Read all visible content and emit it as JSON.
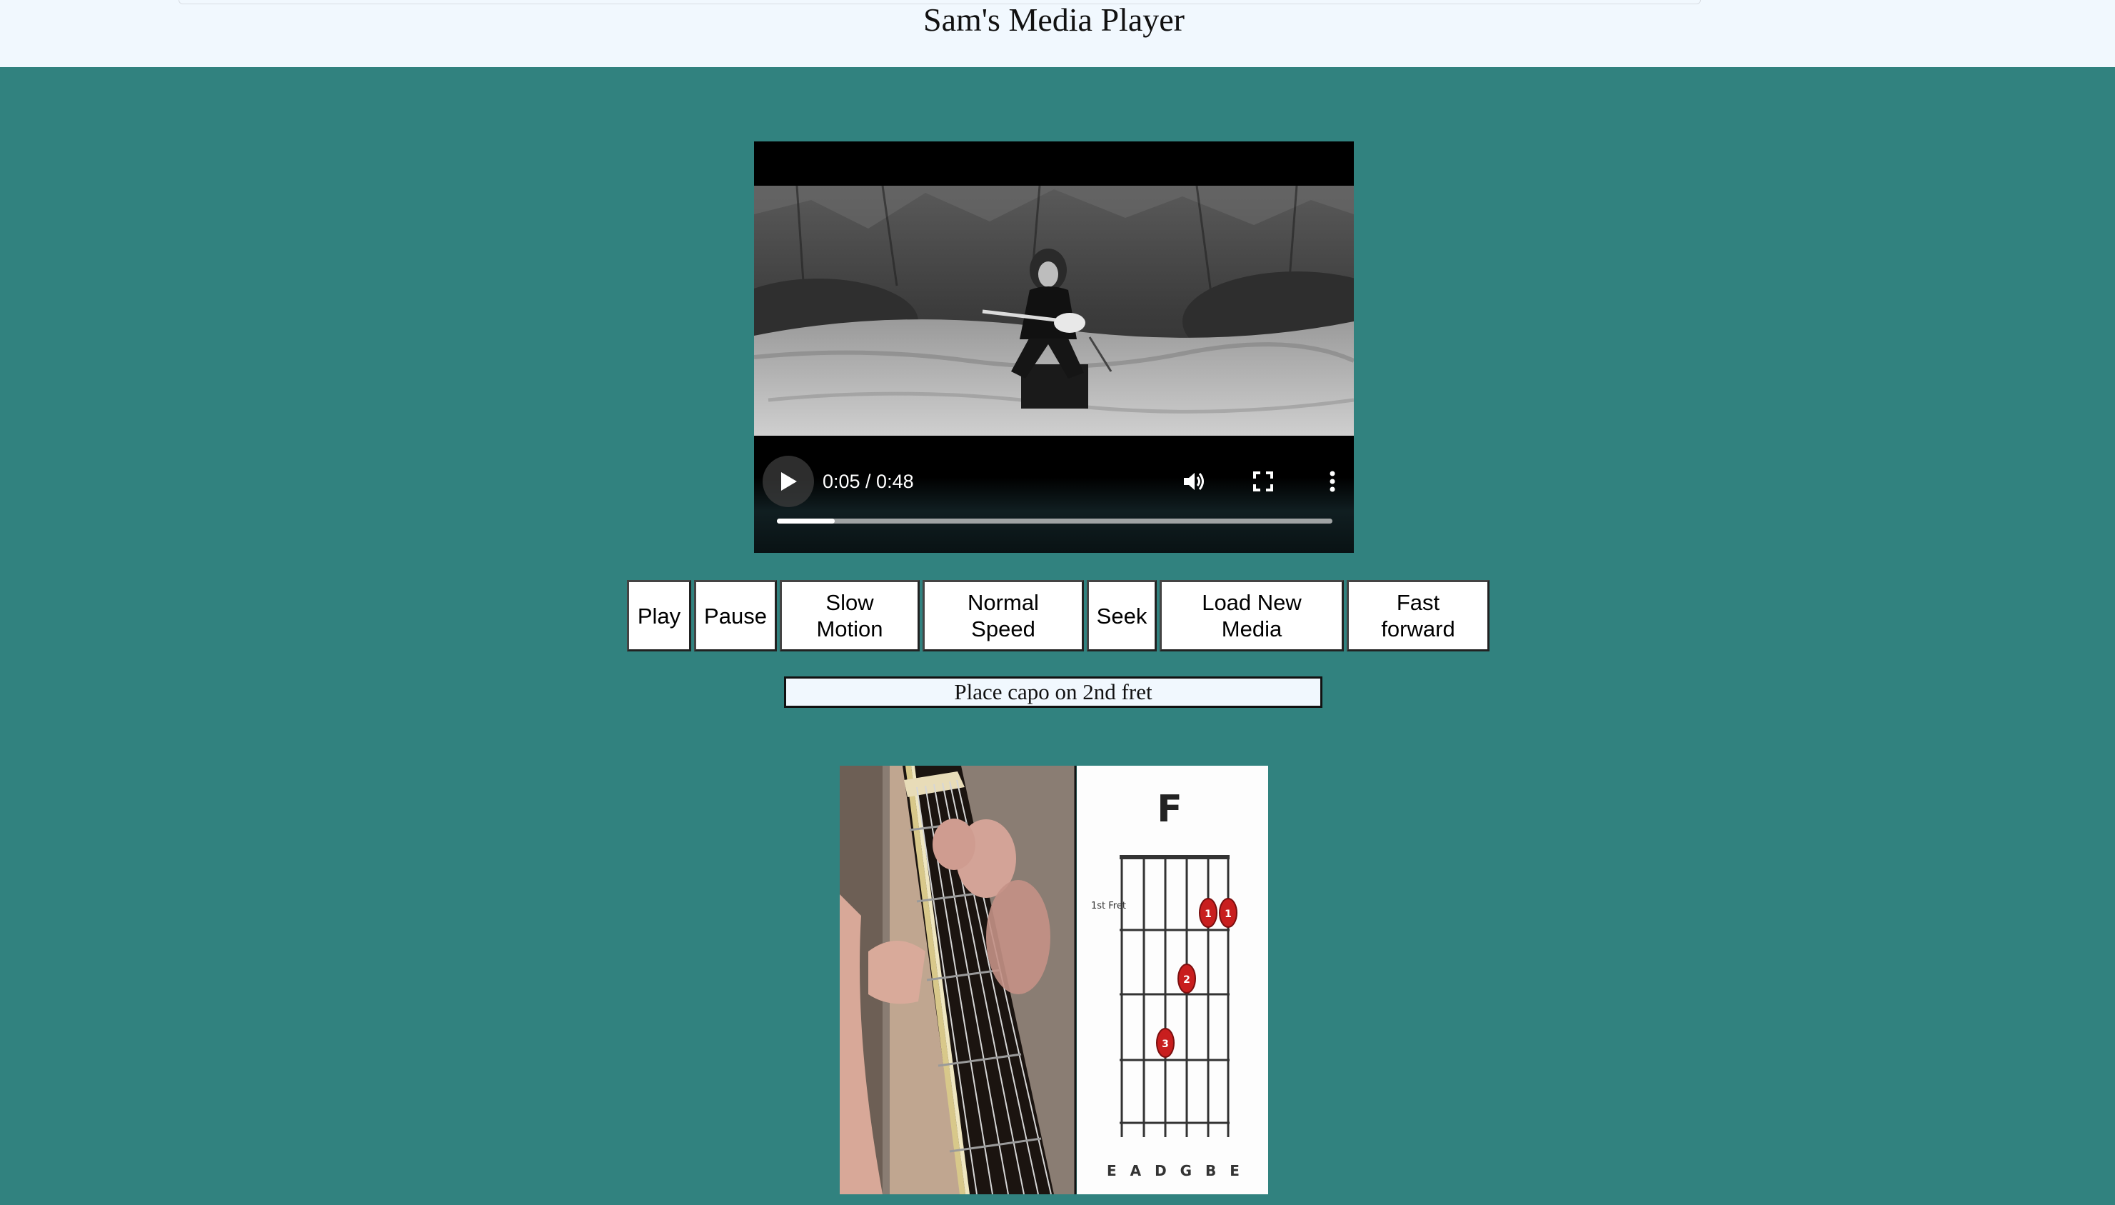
{
  "header": {
    "title": "Sam's Media Player"
  },
  "player": {
    "time": "0:05 / 0:48",
    "progress_fraction": 0.104,
    "icons": [
      "play-icon",
      "volume-icon",
      "fullscreen-icon",
      "more-options-icon"
    ]
  },
  "buttons": [
    {
      "label": "Play"
    },
    {
      "label": "Pause"
    },
    {
      "label": "Slow Motion"
    },
    {
      "label": "Normal Speed"
    },
    {
      "label": "Seek"
    },
    {
      "label": "Load New Media"
    },
    {
      "label": "Fast forward"
    }
  ],
  "status": {
    "text": "Place capo on 2nd fret"
  },
  "chord": {
    "name": "F",
    "fret_label": "1st Fret",
    "strings": "E A D G B E",
    "fingers": [
      "1",
      "1",
      "2",
      "3"
    ]
  },
  "colors": {
    "background": "#31827f",
    "header": "#f1f8fe",
    "marker": "#c81e1e"
  }
}
